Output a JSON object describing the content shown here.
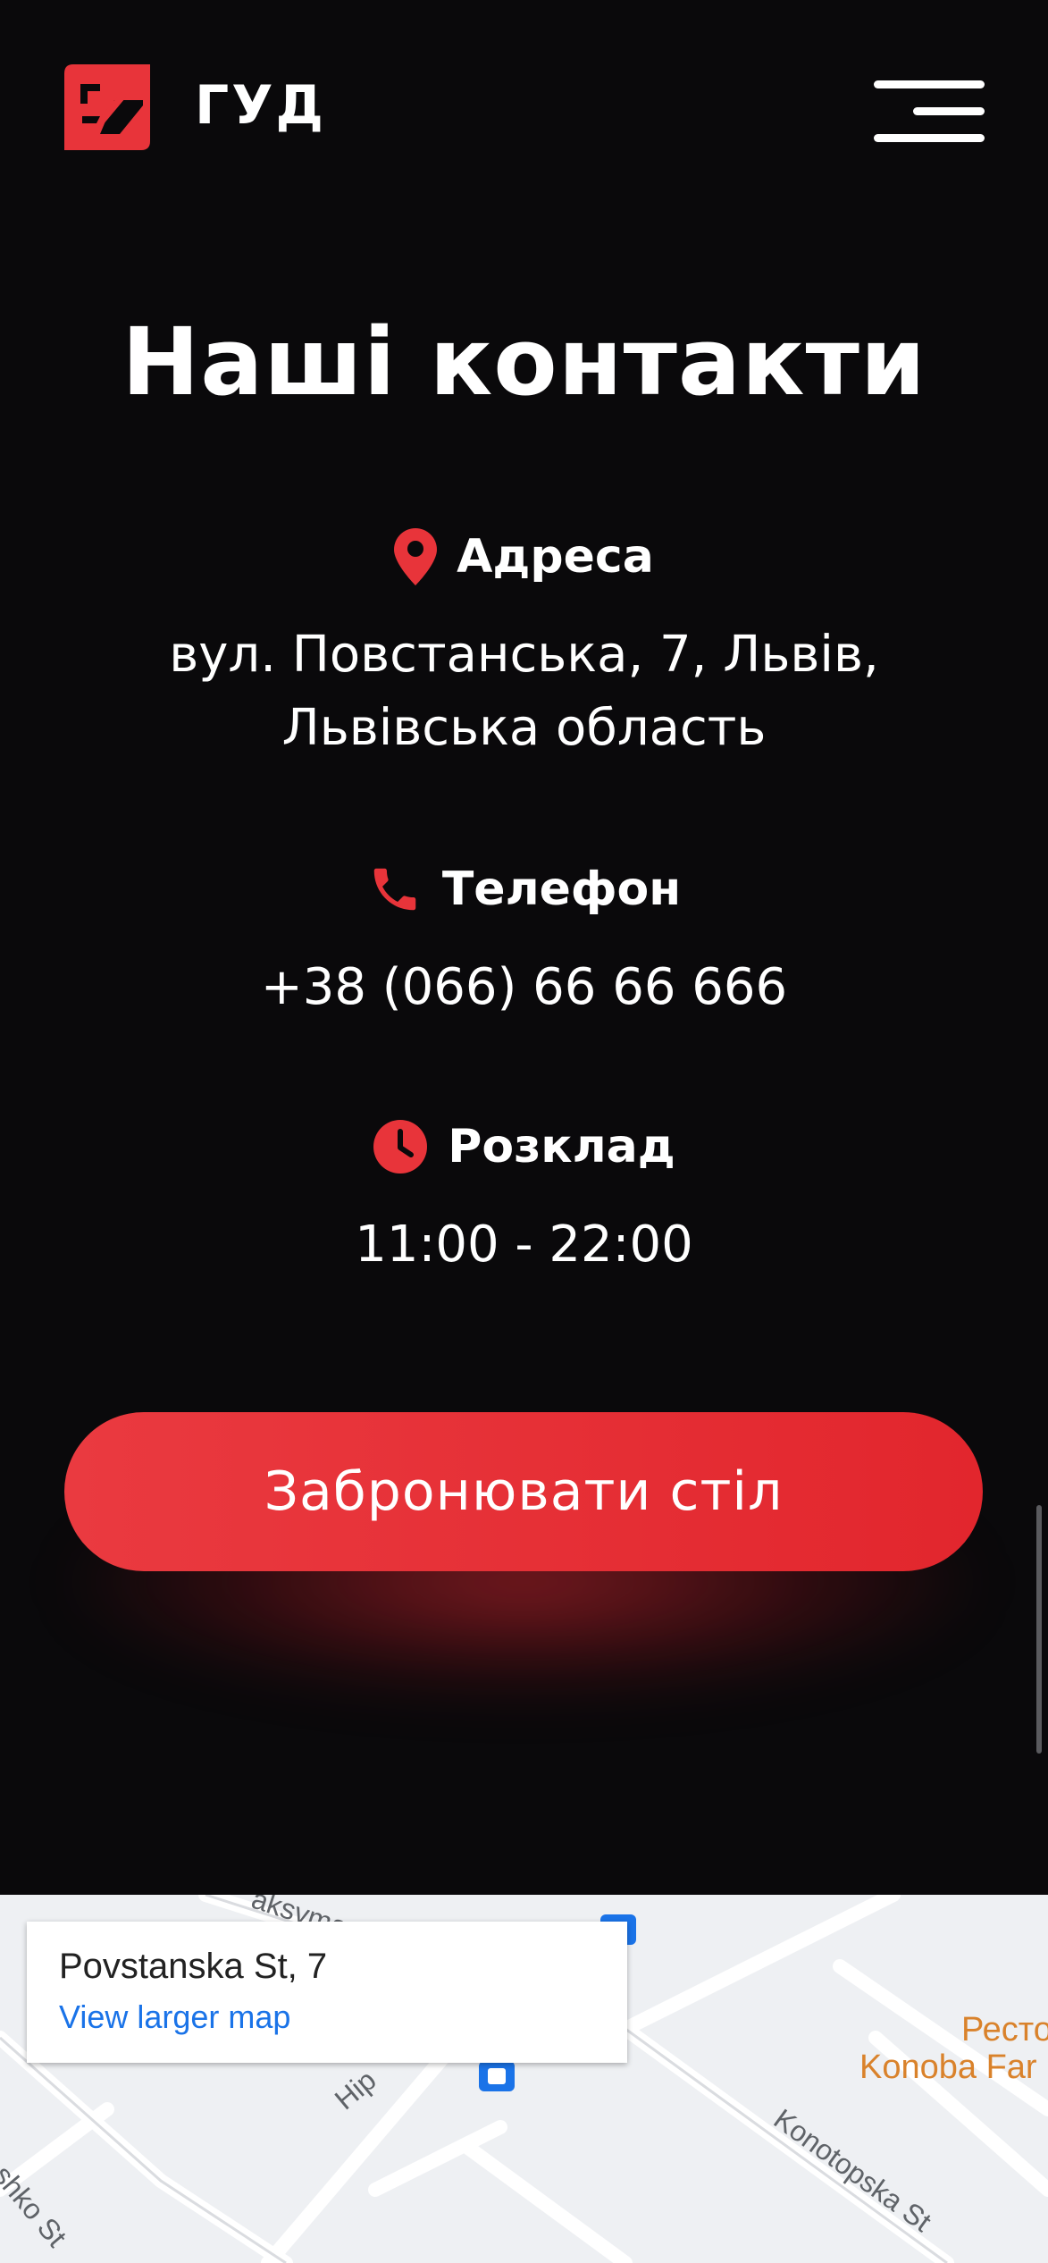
{
  "header": {
    "brand": "ГУД",
    "logo_icon": "brand-logo-icon",
    "menu_icon": "hamburger-menu-icon"
  },
  "contacts": {
    "title": "Наші контакти",
    "address": {
      "label": "Адреса",
      "icon": "location-pin-icon",
      "line1": "вул. Повстанська, 7, Львів,",
      "line2": "Львівська область"
    },
    "phone": {
      "label": "Телефон",
      "icon": "phone-icon",
      "value": "+38 (066) 66 66 666"
    },
    "schedule": {
      "label": "Розклад",
      "icon": "clock-icon",
      "value": "11:00 - 22:00"
    },
    "book_button": "Забронювати стіл"
  },
  "map": {
    "place_name": "Povstanska St, 7",
    "view_larger": "View larger map",
    "poi_line1": "Ресто",
    "poi_line2": "Konoba Far",
    "street_konotopska": "Konotopska St",
    "street_maksyma": "aksyma",
    "street_hip": "Hip",
    "street_shko": "shko St"
  },
  "colors": {
    "accent": "#e8343a",
    "background": "#0a090b",
    "map_link": "#1a73e8"
  }
}
